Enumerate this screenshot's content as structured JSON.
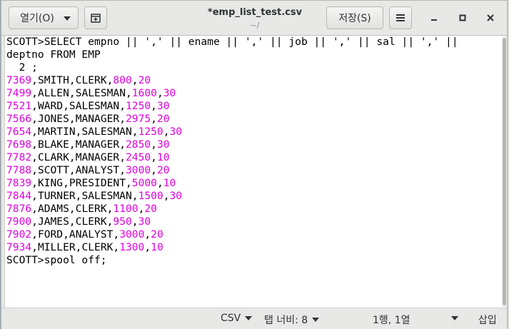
{
  "header": {
    "open_label": "열기(O)",
    "title": "*emp_list_test.csv",
    "subtitle": "~/",
    "save_label": "저장(S)",
    "icons": {
      "open_dropdown": "chevron-down-icon",
      "new_tab": "new-tab-icon",
      "menu": "hamburger-menu-icon",
      "minimize": "minimize-icon",
      "maximize": "maximize-icon",
      "close": "close-icon"
    }
  },
  "editor": {
    "lines": [
      {
        "t": "SCOTT>SELECT empno || ',' || ename || ',' || job || ',' || sal || ',' ||"
      },
      {
        "t": "deptno FROM EMP"
      },
      {
        "t": "  2 ;"
      },
      {
        "empno": "7369",
        "ename": "SMITH",
        "job": "CLERK",
        "sal": "800",
        "deptno": "20"
      },
      {
        "empno": "7499",
        "ename": "ALLEN",
        "job": "SALESMAN",
        "sal": "1600",
        "deptno": "30"
      },
      {
        "empno": "7521",
        "ename": "WARD",
        "job": "SALESMAN",
        "sal": "1250",
        "deptno": "30"
      },
      {
        "empno": "7566",
        "ename": "JONES",
        "job": "MANAGER",
        "sal": "2975",
        "deptno": "20"
      },
      {
        "empno": "7654",
        "ename": "MARTIN",
        "job": "SALESMAN",
        "sal": "1250",
        "deptno": "30"
      },
      {
        "empno": "7698",
        "ename": "BLAKE",
        "job": "MANAGER",
        "sal": "2850",
        "deptno": "30"
      },
      {
        "empno": "7782",
        "ename": "CLARK",
        "job": "MANAGER",
        "sal": "2450",
        "deptno": "10"
      },
      {
        "empno": "7788",
        "ename": "SCOTT",
        "job": "ANALYST",
        "sal": "3000",
        "deptno": "20"
      },
      {
        "empno": "7839",
        "ename": "KING",
        "job": "PRESIDENT",
        "sal": "5000",
        "deptno": "10"
      },
      {
        "empno": "7844",
        "ename": "TURNER",
        "job": "SALESMAN",
        "sal": "1500",
        "deptno": "30"
      },
      {
        "empno": "7876",
        "ename": "ADAMS",
        "job": "CLERK",
        "sal": "1100",
        "deptno": "20"
      },
      {
        "empno": "7900",
        "ename": "JAMES",
        "job": "CLERK",
        "sal": "950",
        "deptno": "30"
      },
      {
        "empno": "7902",
        "ename": "FORD",
        "job": "ANALYST",
        "sal": "3000",
        "deptno": "20"
      },
      {
        "empno": "7934",
        "ename": "MILLER",
        "job": "CLERK",
        "sal": "1300",
        "deptno": "10"
      },
      {
        "t": "SCOTT>spool off;"
      }
    ],
    "number_color": "#e000e0"
  },
  "statusbar": {
    "language": "CSV",
    "tab_width": "탭 너비: 8",
    "position": "1행, 1열",
    "mode": "삽입"
  }
}
